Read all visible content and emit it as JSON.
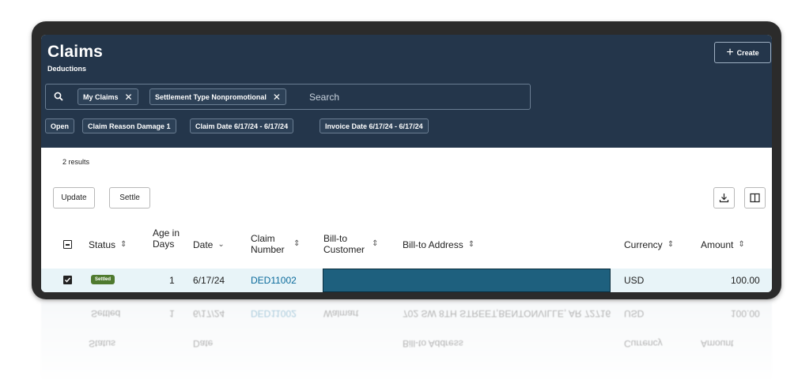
{
  "header": {
    "title": "Claims",
    "subtitle": "Deductions",
    "create_label": "Create"
  },
  "search": {
    "placeholder": "Search",
    "chips": [
      {
        "label": "My Claims"
      },
      {
        "label": "Settlement Type Nonpromotional"
      }
    ]
  },
  "filters": [
    {
      "label": "Open"
    },
    {
      "label": "Claim Reason Damage 1"
    },
    {
      "label": "Claim Date 6/17/24 - 6/17/24"
    },
    {
      "label": "Invoice Date 6/17/24 - 6/17/24"
    }
  ],
  "toolbar": {
    "results": "2 results",
    "update_label": "Update",
    "settle_label": "Settle",
    "icons": [
      "download-icon",
      "columns-icon"
    ]
  },
  "table": {
    "columns": {
      "status": "Status",
      "age": "Age in Days",
      "date": "Date",
      "claim_number": "Claim Number",
      "bill_to_customer": "Bill-to Customer",
      "bill_to_address": "Bill-to Address",
      "currency": "Currency",
      "amount": "Amount"
    },
    "rows": [
      {
        "status": "Settled",
        "age": "1",
        "date": "6/17/24",
        "claim_number": "DED11002",
        "currency": "USD",
        "amount": "100.00",
        "selected": true
      }
    ],
    "reflection": {
      "customer": "Walmart",
      "address": "702 SW 8TH STREET,BENTONVILLE, AR 72716"
    }
  },
  "colors": {
    "header_bg": "#24364b",
    "badge_green": "#4f7a2f",
    "link": "#0a6a9b",
    "selected_row": "#e8f4f8"
  }
}
